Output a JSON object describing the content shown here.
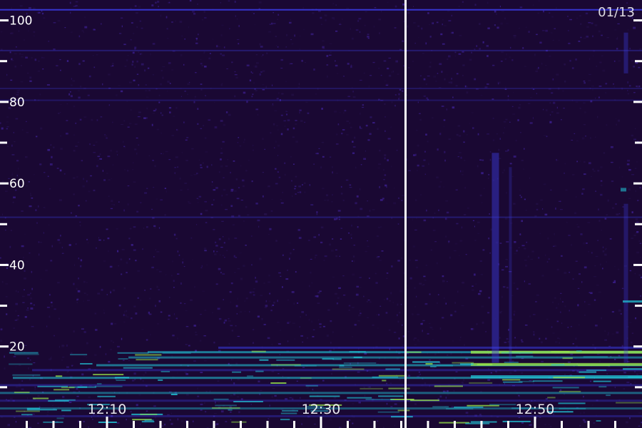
{
  "date_label": "01/13",
  "colors": {
    "background": "#1a0833",
    "noise_low": "#241048",
    "noise_high": "#3a1e8a",
    "line": "#3b3be0",
    "strong": "#22ccdd",
    "peak": "#9be84a",
    "axis": "#ffffff"
  },
  "chart_data": {
    "type": "heatmap",
    "title": "",
    "xlabel": "",
    "ylabel": "",
    "y_ticks": [
      "20",
      "40",
      "60",
      "80",
      "100"
    ],
    "x_ticks": [
      "12:10",
      "12:30",
      "12:50"
    ],
    "y_range": [
      0,
      105
    ],
    "x_range_minutes": [
      0,
      60
    ],
    "x_tick_minutes": [
      10,
      30,
      50
    ],
    "marker_minute": 37.9,
    "grid": false
  }
}
